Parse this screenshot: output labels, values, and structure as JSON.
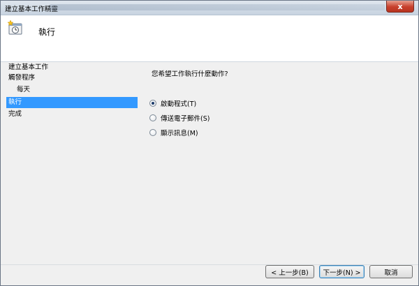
{
  "window": {
    "title": "建立基本工作精靈",
    "close_label": "x"
  },
  "header": {
    "title": "執行"
  },
  "sidebar": {
    "items": [
      {
        "label": "建立基本工作"
      },
      {
        "label": "觸發程序"
      },
      {
        "label": "每天"
      },
      {
        "label": "執行"
      },
      {
        "label": "完成"
      }
    ],
    "active_index": 3
  },
  "main": {
    "question": "您希望工作執行什麼動作?",
    "options": [
      {
        "label": "啟動程式(T)",
        "checked": true
      },
      {
        "label": "傳送電子郵件(S)",
        "checked": false
      },
      {
        "label": "顯示訊息(M)",
        "checked": false
      }
    ]
  },
  "footer": {
    "back_label": "< 上一步(B)",
    "next_label": "下一步(N) >",
    "cancel_label": "取消"
  },
  "colors": {
    "selection": "#3399ff",
    "header_bg": "#ffffff",
    "window_bg": "#f0f0f0"
  }
}
